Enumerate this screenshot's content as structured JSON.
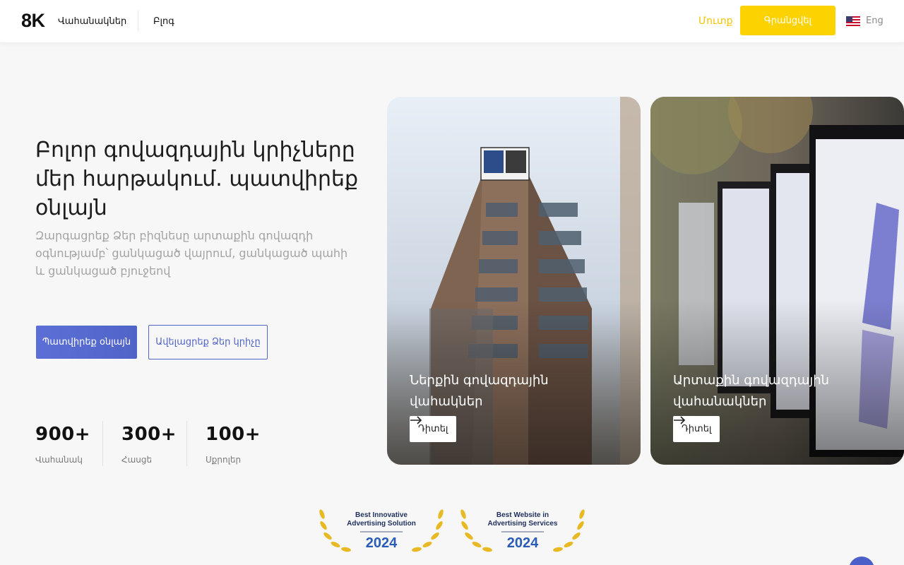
{
  "header": {
    "logo": "8K",
    "nav": {
      "billboards": "Վահանակներ",
      "blog": "Բլոգ"
    },
    "login": "Մուտք",
    "signup": "Գրանցվել",
    "language": "Eng"
  },
  "hero": {
    "title": "Բոլոր գովազդային կրիչները մեր հարթակում. պատվիրեք օնլայն",
    "subtitle": "Զարգացրեք Ձեր բիզնեսը արտաքին գովազդի օգնությամբ՝ ցանկացած վայրում, ցանկացած պահի և ցանկացած բյուջեով",
    "primary_button": "Պատվիրեք օնլայն",
    "secondary_button": "Ավելացրեք Ձեր կրիչը"
  },
  "stats": [
    {
      "value": "900+",
      "label": "Վահանակ"
    },
    {
      "value": "300+",
      "label": "Հասցե"
    },
    {
      "value": "100+",
      "label": "Սքրոլեր"
    }
  ],
  "cards": [
    {
      "title": "Ներքին գովազդային վահակներ",
      "button": "Դիտել"
    },
    {
      "title": "Արտաքին գովազդային վահանակներ",
      "button": "Դիտել"
    }
  ],
  "awards": [
    {
      "title": "Best Innovative Advertising Solution",
      "year": "2024"
    },
    {
      "title": "Best Website in Advertising Services",
      "year": "2024"
    }
  ],
  "colors": {
    "accent": "#fcd200",
    "primary": "#5064c8",
    "background": "#f7f7f7"
  }
}
